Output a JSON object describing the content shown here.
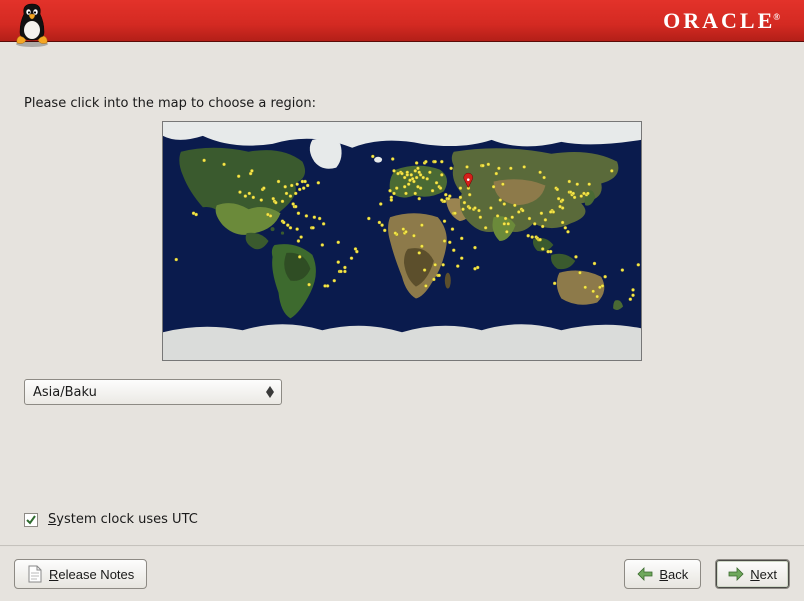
{
  "brand": {
    "logo_text": "ORACLE"
  },
  "instruction": "Please click into the map to choose a region:",
  "timezone": {
    "selected": "Asia/Baku",
    "marker": {
      "lat": 40.4,
      "lon": 49.9
    }
  },
  "utc": {
    "label": "System clock uses UTC",
    "checked": true
  },
  "footer": {
    "release_notes": "Release Notes",
    "back": "Back",
    "next": "Next"
  },
  "colors": {
    "header": "#d42a22",
    "ocean": "#0a1b4d",
    "land_dark": "#2f4d24",
    "land_light": "#8d7a4a",
    "ice": "#e7eaea",
    "city_dot": "#f6e84a",
    "marker": "#d4201a"
  },
  "city_lonlat": [
    [
      -157,
      21
    ],
    [
      -149,
      61
    ],
    [
      -123,
      49
    ],
    [
      -122,
      37
    ],
    [
      -118,
      34
    ],
    [
      -115,
      36
    ],
    [
      -112,
      33
    ],
    [
      -106,
      31
    ],
    [
      -105,
      39
    ],
    [
      -104,
      40
    ],
    [
      -99,
      19
    ],
    [
      -97,
      32
    ],
    [
      -96,
      30
    ],
    [
      -95,
      29
    ],
    [
      -93,
      45
    ],
    [
      -90,
      30
    ],
    [
      -90,
      15
    ],
    [
      -88,
      41
    ],
    [
      -87,
      36
    ],
    [
      -84,
      34
    ],
    [
      -84,
      10
    ],
    [
      -83,
      42
    ],
    [
      -82,
      28
    ],
    [
      -81,
      26
    ],
    [
      -80,
      26
    ],
    [
      -80,
      36
    ],
    [
      -79,
      43
    ],
    [
      -78,
      0
    ],
    [
      -77,
      39
    ],
    [
      -77,
      -12
    ],
    [
      -76,
      3
    ],
    [
      -75,
      45
    ],
    [
      -74,
      40
    ],
    [
      -73,
      45
    ],
    [
      -71,
      42
    ],
    [
      -70,
      -33
    ],
    [
      -68,
      10
    ],
    [
      -66,
      18
    ],
    [
      -63,
      44
    ],
    [
      -60,
      -3
    ],
    [
      -58,
      -34
    ],
    [
      -56,
      -34
    ],
    [
      -51,
      -30
    ],
    [
      -48,
      -16
    ],
    [
      -47,
      -23
    ],
    [
      -46,
      -23
    ],
    [
      -43,
      -23
    ],
    [
      -38,
      -13
    ],
    [
      -35,
      -6
    ],
    [
      -17,
      14
    ],
    [
      -16,
      28
    ],
    [
      -9,
      38
    ],
    [
      -8,
      33
    ],
    [
      -7,
      62
    ],
    [
      -6,
      53
    ],
    [
      -6,
      36
    ],
    [
      -4,
      40
    ],
    [
      -4,
      5
    ],
    [
      -3,
      51
    ],
    [
      -1,
      52
    ],
    [
      0,
      51
    ],
    [
      2,
      48
    ],
    [
      2,
      41
    ],
    [
      2,
      6
    ],
    [
      3,
      36
    ],
    [
      4,
      52
    ],
    [
      4,
      50
    ],
    [
      5,
      43
    ],
    [
      6,
      46
    ],
    [
      7,
      50
    ],
    [
      8,
      47
    ],
    [
      9,
      45
    ],
    [
      10,
      36
    ],
    [
      10,
      53
    ],
    [
      11,
      48
    ],
    [
      11,
      59
    ],
    [
      12,
      55
    ],
    [
      12,
      41
    ],
    [
      13,
      52
    ],
    [
      13,
      32
    ],
    [
      14,
      50
    ],
    [
      14,
      40
    ],
    [
      15,
      -4
    ],
    [
      16,
      48
    ],
    [
      17,
      59
    ],
    [
      18,
      60
    ],
    [
      18,
      -34
    ],
    [
      19,
      47
    ],
    [
      21,
      52
    ],
    [
      23,
      38
    ],
    [
      24,
      60
    ],
    [
      25,
      60
    ],
    [
      26,
      44
    ],
    [
      27,
      -26
    ],
    [
      28,
      41
    ],
    [
      28,
      -26
    ],
    [
      29,
      40
    ],
    [
      30,
      50
    ],
    [
      30,
      60
    ],
    [
      31,
      30
    ],
    [
      31,
      -18
    ],
    [
      32,
      0
    ],
    [
      32,
      15
    ],
    [
      33,
      35
    ],
    [
      34,
      32
    ],
    [
      35,
      32
    ],
    [
      36,
      -1
    ],
    [
      37,
      55
    ],
    [
      38,
      9
    ],
    [
      39,
      21
    ],
    [
      44,
      33
    ],
    [
      44,
      40
    ],
    [
      45,
      2
    ],
    [
      46,
      24
    ],
    [
      47,
      29
    ],
    [
      49,
      56
    ],
    [
      50,
      26
    ],
    [
      51,
      35
    ],
    [
      51,
      25
    ],
    [
      54,
      24
    ],
    [
      55,
      25
    ],
    [
      55,
      -21
    ],
    [
      58,
      23
    ],
    [
      59,
      18
    ],
    [
      60,
      57
    ],
    [
      67,
      25
    ],
    [
      69,
      41
    ],
    [
      72,
      19
    ],
    [
      73,
      55
    ],
    [
      74,
      31
    ],
    [
      76,
      43
    ],
    [
      77,
      28
    ],
    [
      77,
      13
    ],
    [
      78,
      17
    ],
    [
      80,
      13
    ],
    [
      82,
      55
    ],
    [
      85,
      27
    ],
    [
      88,
      22
    ],
    [
      90,
      24
    ],
    [
      96,
      17
    ],
    [
      100,
      13
    ],
    [
      101,
      3
    ],
    [
      102,
      2
    ],
    [
      103,
      1
    ],
    [
      104,
      1
    ],
    [
      105,
      21
    ],
    [
      106,
      -6
    ],
    [
      106,
      11
    ],
    [
      108,
      16
    ],
    [
      110,
      -8
    ],
    [
      112,
      -8
    ],
    [
      113,
      23
    ],
    [
      114,
      22
    ],
    [
      115,
      -32
    ],
    [
      116,
      40
    ],
    [
      117,
      39
    ],
    [
      118,
      32
    ],
    [
      120,
      30
    ],
    [
      121,
      31
    ],
    [
      121,
      14
    ],
    [
      121,
      25
    ],
    [
      125,
      7
    ],
    [
      126,
      37
    ],
    [
      127,
      37
    ],
    [
      128,
      35
    ],
    [
      130,
      33
    ],
    [
      131,
      -12
    ],
    [
      135,
      34
    ],
    [
      138,
      -35
    ],
    [
      139,
      35
    ],
    [
      141,
      43
    ],
    [
      144,
      -38
    ],
    [
      147,
      -42
    ],
    [
      151,
      -34
    ],
    [
      153,
      -27
    ],
    [
      166,
      -22
    ],
    [
      174,
      -37
    ],
    [
      174,
      -41
    ],
    [
      -170,
      -14
    ],
    [
      -155,
      20
    ],
    [
      -134,
      58
    ],
    [
      -114,
      51
    ],
    [
      -113,
      53
    ],
    [
      -101,
      20
    ],
    [
      -89,
      14
    ],
    [
      -86,
      12
    ],
    [
      -79,
      9
    ],
    [
      -78,
      21
    ],
    [
      -72,
      19
    ],
    [
      -67,
      10
    ],
    [
      -62,
      17
    ],
    [
      -59,
      13
    ],
    [
      -48,
      -1
    ],
    [
      -43,
      -20
    ],
    [
      -34,
      -8
    ],
    [
      -25,
      17
    ],
    [
      -22,
      64
    ],
    [
      -15,
      12
    ],
    [
      -13,
      8
    ],
    [
      -8,
      31
    ],
    [
      -5,
      6
    ],
    [
      1,
      9
    ],
    [
      3,
      7
    ],
    [
      9,
      4
    ],
    [
      13,
      -9
    ],
    [
      15,
      12
    ],
    [
      17,
      -22
    ],
    [
      24,
      -29
    ],
    [
      25,
      -18
    ],
    [
      30,
      31
    ],
    [
      32,
      30
    ],
    [
      36,
      34
    ],
    [
      39,
      -7
    ],
    [
      40,
      21
    ],
    [
      42,
      -19
    ],
    [
      45,
      -13
    ],
    [
      50,
      40
    ],
    [
      55,
      -5
    ],
    [
      57,
      -20
    ],
    [
      61,
      57
    ],
    [
      63,
      10
    ],
    [
      65,
      58
    ],
    [
      71,
      51
    ],
    [
      79,
      7
    ],
    [
      83,
      18
    ],
    [
      91,
      23
    ],
    [
      92,
      56
    ],
    [
      95,
      4
    ],
    [
      98,
      3
    ],
    [
      104,
      52
    ],
    [
      107,
      48
    ],
    [
      112,
      22
    ],
    [
      119,
      26
    ],
    [
      123,
      10
    ],
    [
      126,
      45
    ],
    [
      129,
      36
    ],
    [
      132,
      43
    ],
    [
      134,
      -24
    ],
    [
      137,
      36
    ],
    [
      140,
      36
    ],
    [
      145,
      -17
    ],
    [
      149,
      -35
    ],
    [
      158,
      53
    ],
    [
      172,
      -44
    ],
    [
      178,
      -18
    ]
  ]
}
